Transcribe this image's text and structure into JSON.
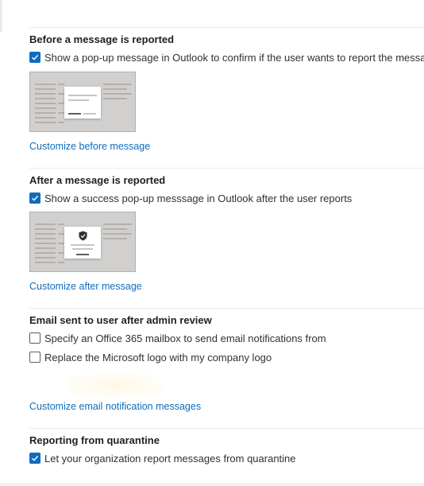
{
  "sections": [
    {
      "heading": "Before a message is reported",
      "checkbox": {
        "label": "Show a pop-up message in Outlook to confirm if the user wants to report the message",
        "checked": true
      },
      "link": "Customize before message"
    },
    {
      "heading": "After a message is reported",
      "checkbox": {
        "label": "Show a success pop-up messsage in Outlook after the user reports",
        "checked": true
      },
      "link": "Customize after message"
    },
    {
      "heading": "Email sent to user after admin review",
      "checkboxes": [
        {
          "label": "Specify an Office 365 mailbox to send email notifications from",
          "checked": false
        },
        {
          "label": "Replace the Microsoft logo with my company logo",
          "checked": false
        }
      ],
      "link": "Customize email notification messages"
    },
    {
      "heading": "Reporting from quarantine",
      "checkbox": {
        "label": "Let your organization report messages from quarantine",
        "checked": true
      }
    }
  ],
  "icons": {
    "checkmark": "checkmark-icon",
    "shield": "shield-check-icon"
  },
  "colors": {
    "accent": "#0f6cbd",
    "divider": "#edebe9"
  }
}
